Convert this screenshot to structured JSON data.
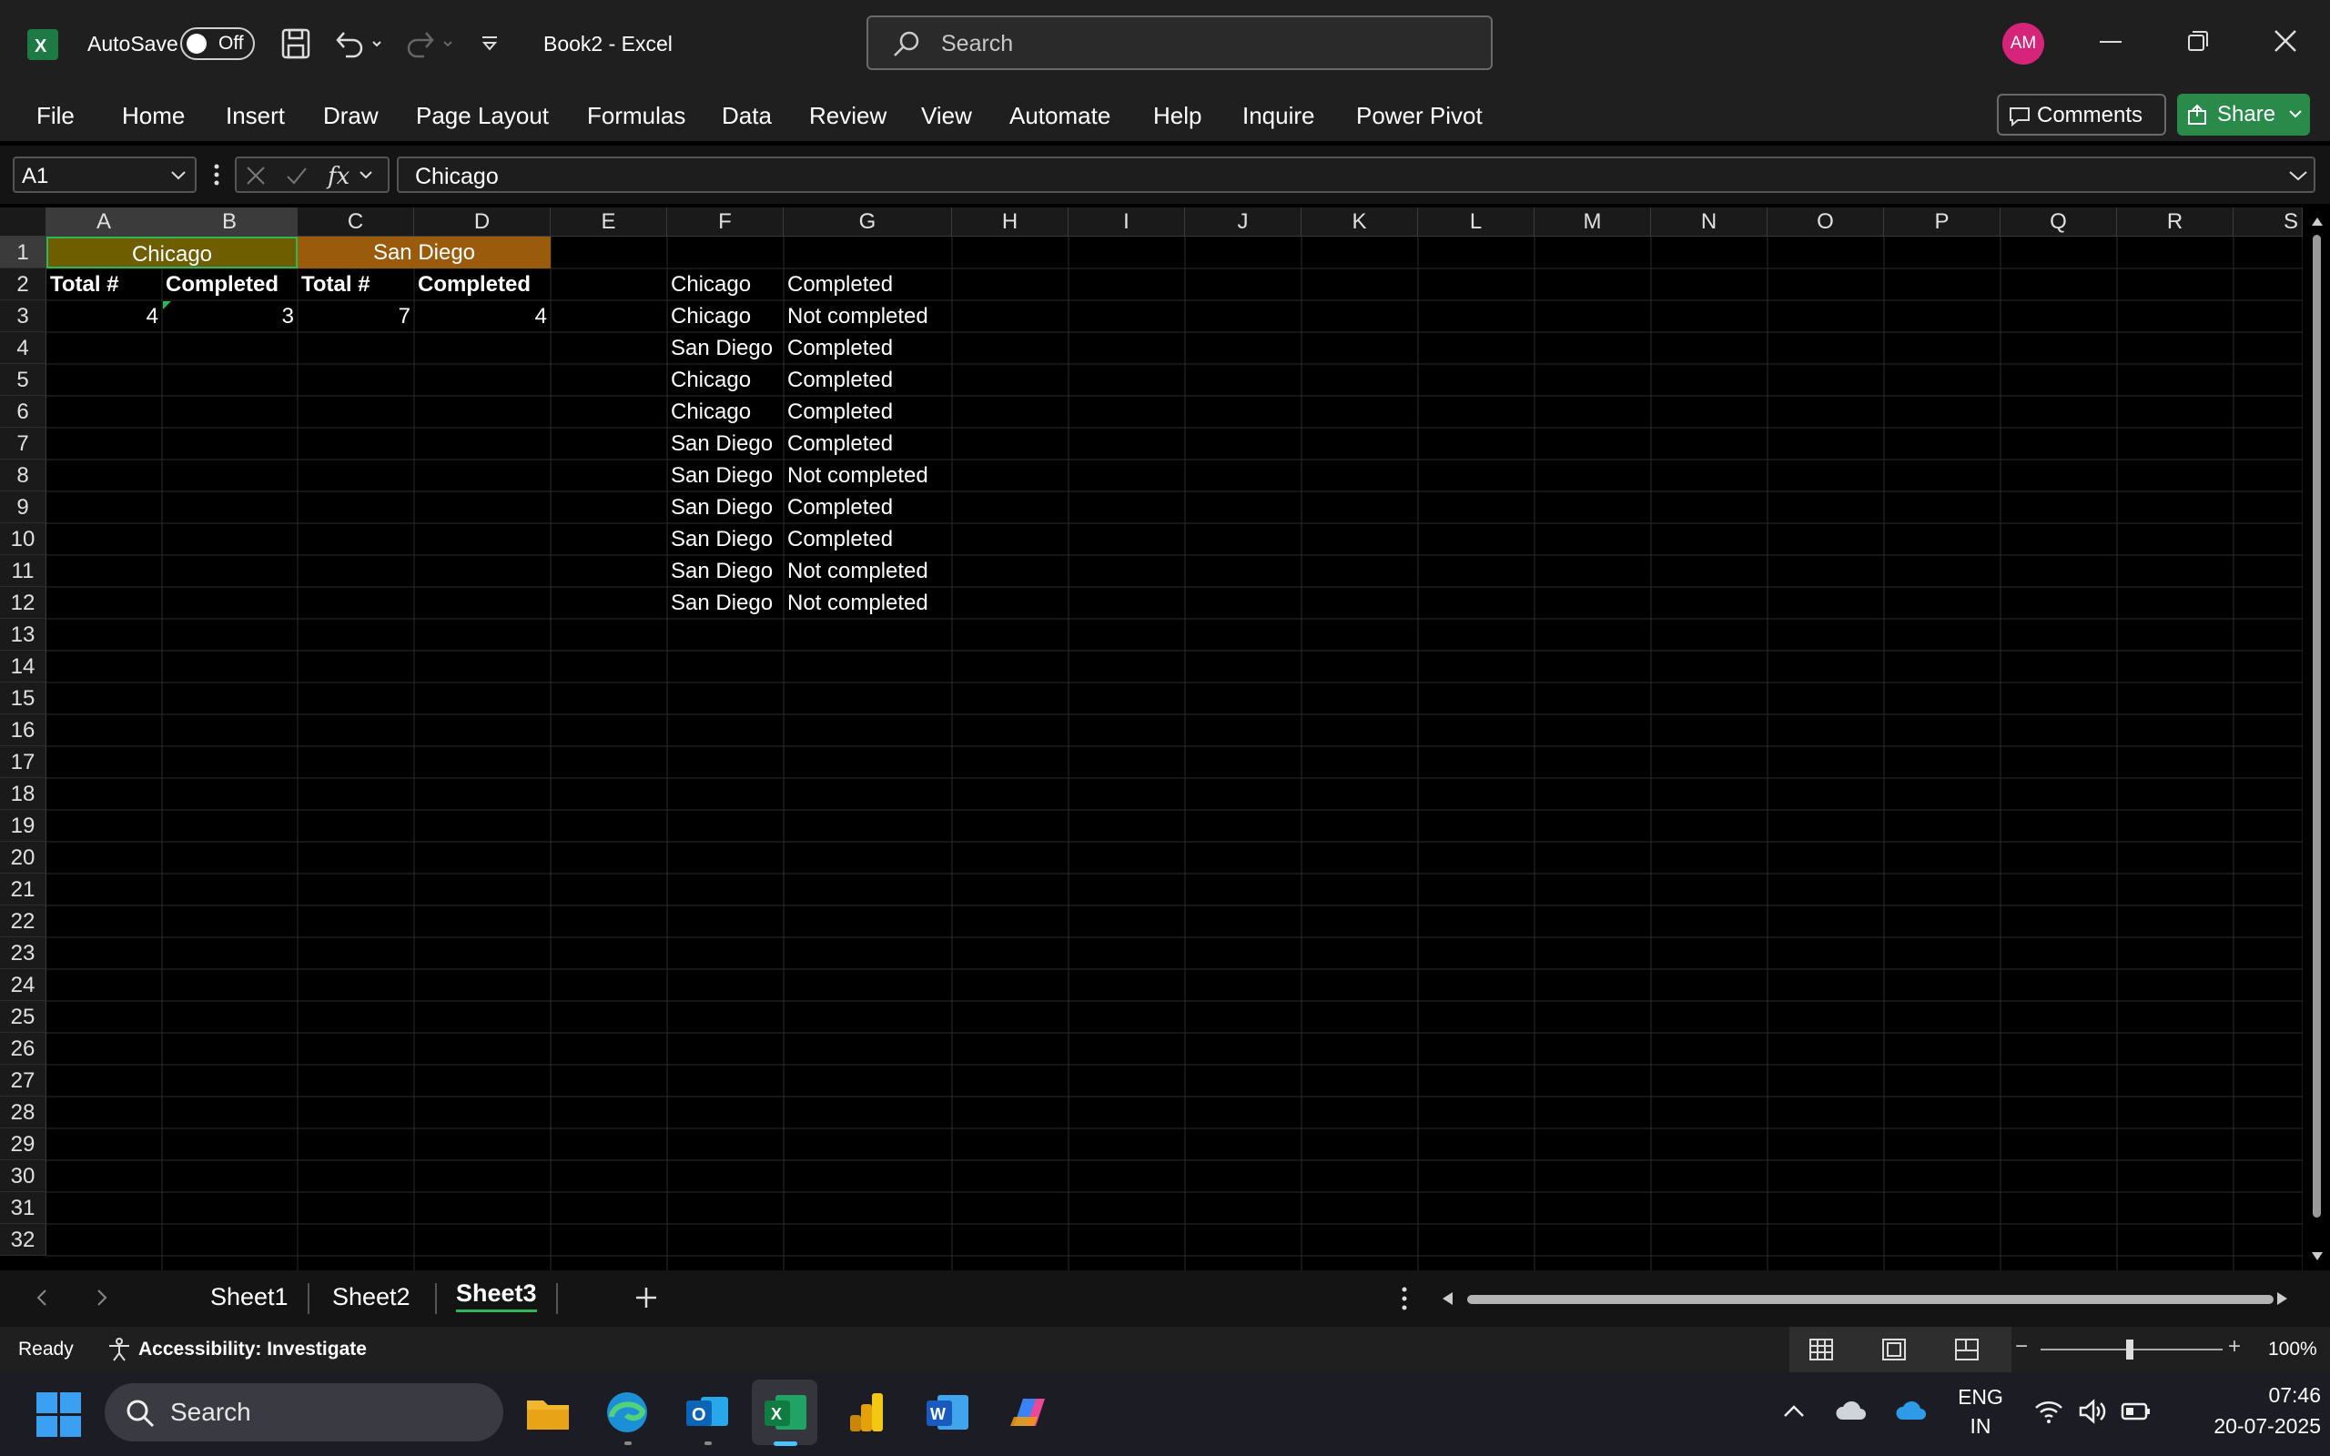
{
  "titlebar": {
    "autosave_label": "AutoSave",
    "autosave_state": "Off",
    "document_title": "Book2  -  Excel",
    "search_placeholder": "Search",
    "avatar_initials": "AM"
  },
  "ribbon": {
    "tabs": [
      "File",
      "Home",
      "Insert",
      "Draw",
      "Page Layout",
      "Formulas",
      "Data",
      "Review",
      "View",
      "Automate",
      "Help",
      "Inquire",
      "Power Pivot"
    ],
    "comments_label": "Comments",
    "share_label": "Share"
  },
  "formula_bar": {
    "name_box": "A1",
    "formula": "Chicago"
  },
  "grid": {
    "columns": [
      "A",
      "B",
      "C",
      "D",
      "E",
      "F",
      "G",
      "H",
      "I",
      "J",
      "K",
      "L",
      "M",
      "N",
      "O",
      "P",
      "Q",
      "R",
      "S"
    ],
    "rows": [
      "1",
      "2",
      "3",
      "4",
      "5",
      "6",
      "7",
      "8",
      "9",
      "10",
      "11",
      "12",
      "13",
      "14",
      "15",
      "16",
      "17",
      "18",
      "19",
      "20",
      "21",
      "22",
      "23",
      "24",
      "25",
      "26",
      "27",
      "28",
      "29",
      "30",
      "31",
      "32"
    ],
    "merged_headers": {
      "chicago": "Chicago",
      "san_diego": "San Diego"
    },
    "header_colors": {
      "chicago": "#6e5e00",
      "san_diego": "#9a5c0c"
    },
    "row2": [
      "Total #",
      "Completed",
      "Total #",
      "Completed"
    ],
    "row3": [
      "4",
      "3",
      "7",
      "4"
    ],
    "list_city": [
      "Chicago",
      "Chicago",
      "San Diego",
      "Chicago",
      "Chicago",
      "San Diego",
      "San Diego",
      "San Diego",
      "San Diego",
      "San Diego",
      "San Diego"
    ],
    "list_status": [
      "Completed",
      "Not completed",
      "Completed",
      "Completed",
      "Completed",
      "Completed",
      "Not completed",
      "Completed",
      "Completed",
      "Not completed",
      "Not completed"
    ]
  },
  "sheets": {
    "tabs": [
      "Sheet1",
      "Sheet2",
      "Sheet3"
    ],
    "active": "Sheet3"
  },
  "statusbar": {
    "ready": "Ready",
    "accessibility": "Accessibility: Investigate",
    "zoom": "100%"
  },
  "taskbar": {
    "search_placeholder": "Search",
    "lang_line1": "ENG",
    "lang_line2": "IN",
    "time": "07:46",
    "date": "20-07-2025"
  },
  "colors": {
    "accent_green": "#2eb65a",
    "share_button": "#2a8a4a",
    "avatar": "#d6247a"
  }
}
